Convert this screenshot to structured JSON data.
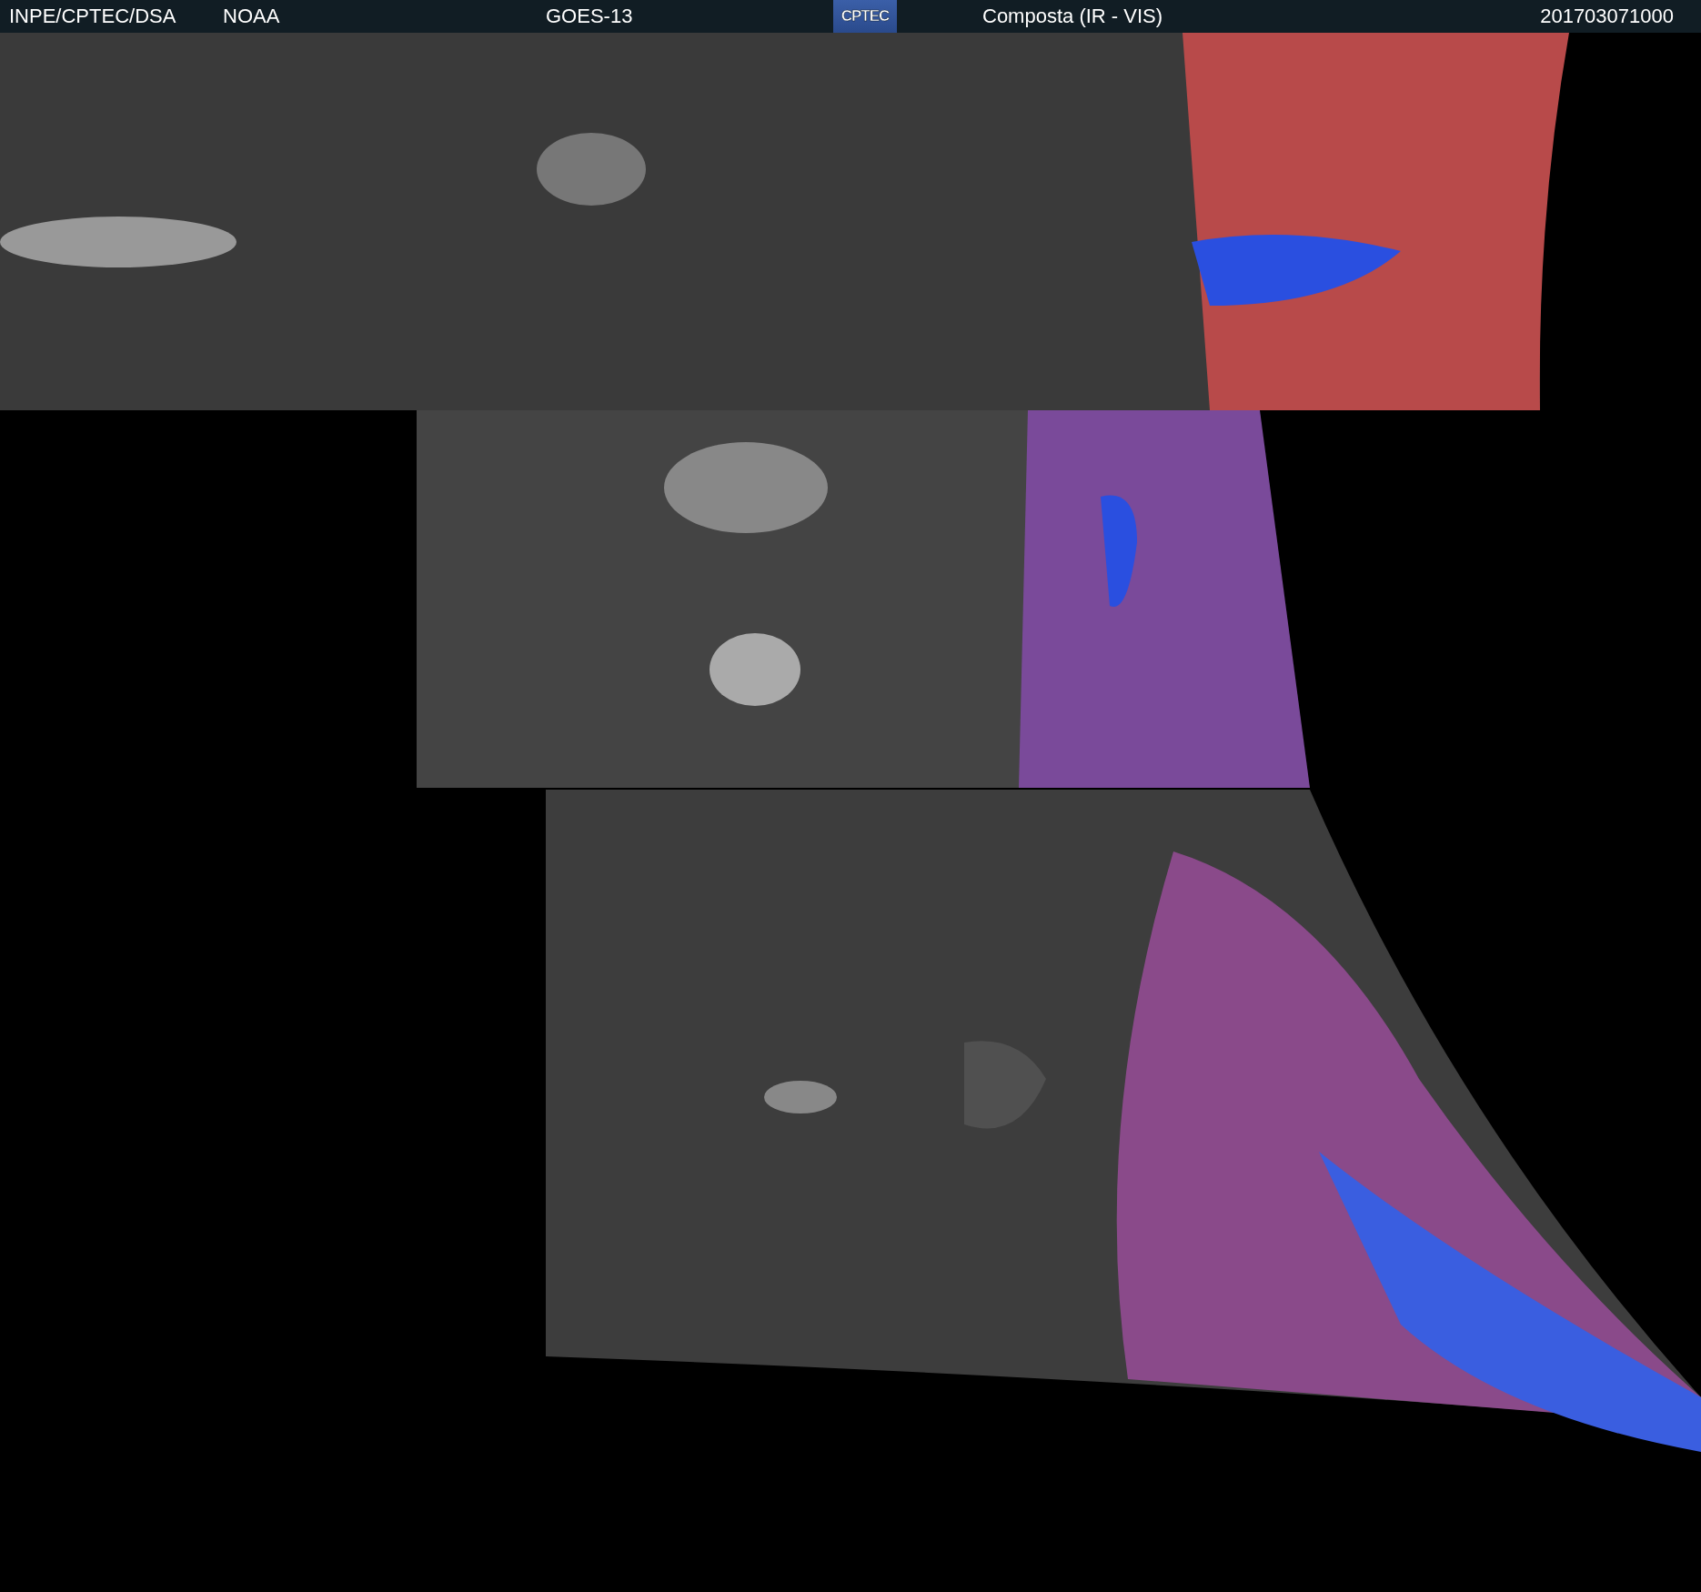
{
  "header": {
    "agency": "INPE/CPTEC/DSA",
    "source": "NOAA",
    "satellite": "GOES-13",
    "logo": "CPTEC",
    "product": "Composta (IR - VIS)",
    "timestamp": "201703071000"
  }
}
